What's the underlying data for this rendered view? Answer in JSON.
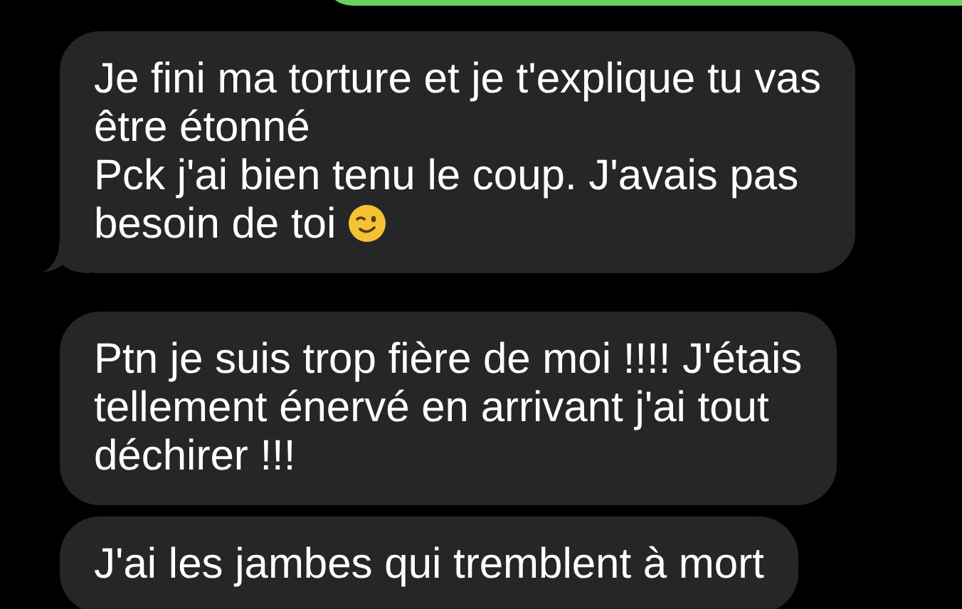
{
  "messages": [
    {
      "kind": "received",
      "tail": true,
      "trailing_emoji": true,
      "lines": [
        "Je fini ma torture et je t'explique tu vas",
        "être étonné",
        "Pck j'ai bien tenu le coup. J'avais pas",
        "besoin de toi"
      ]
    },
    {
      "kind": "received",
      "tail": false,
      "trailing_emoji": false,
      "lines": [
        "Ptn je suis trop fière de moi !!!! J'étais",
        "tellement énervé en arrivant j'ai tout",
        "déchirer !!!"
      ]
    },
    {
      "kind": "received",
      "tail": false,
      "trailing_emoji": false,
      "lines": [
        "J'ai les jambes qui tremblent à mort"
      ]
    }
  ]
}
